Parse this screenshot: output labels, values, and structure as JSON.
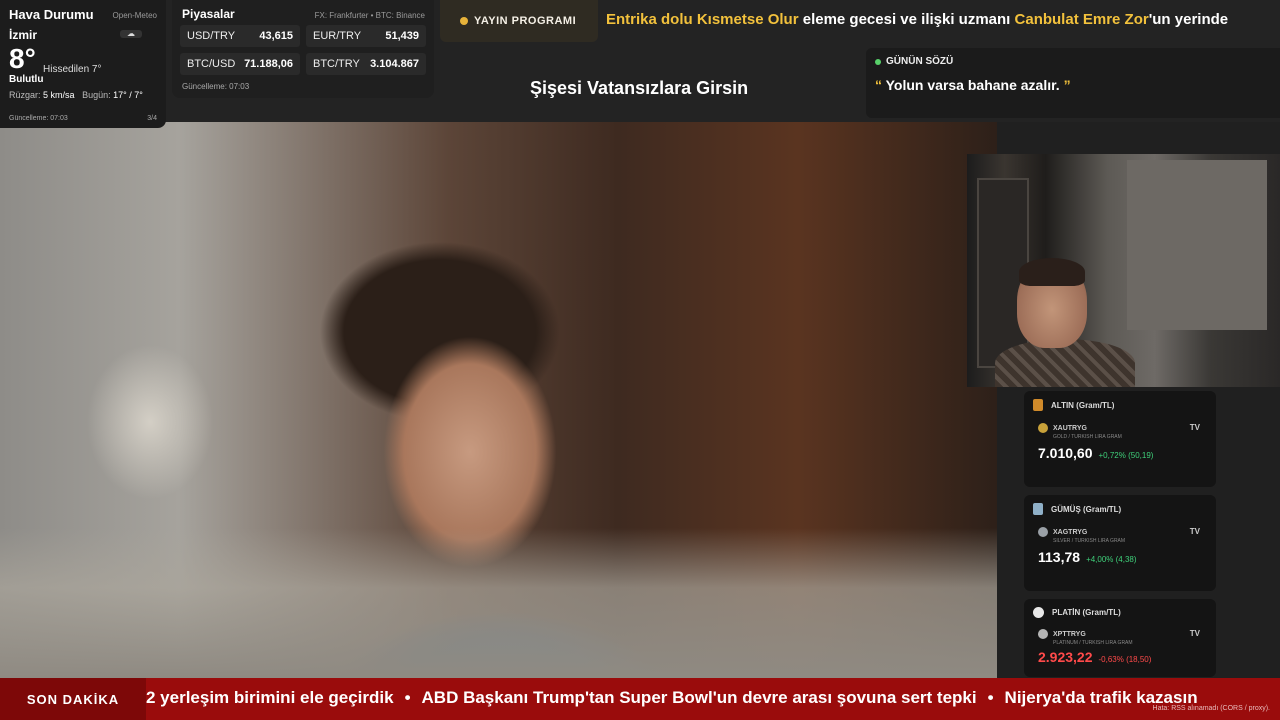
{
  "weather": {
    "title": "Hava Durumu",
    "source": "Open-Meteo",
    "city": "İzmir",
    "temp": "8°",
    "feels_like": "Hissedilen 7°",
    "condition": "Bulutlu",
    "wind_label": "Rüzgar:",
    "wind_value": "5 km/sa",
    "today_label": "Bugün:",
    "today_value": "17° / 7°",
    "updated": "Güncelleme: 07:03",
    "page": "3/4"
  },
  "markets": {
    "title": "Piyasalar",
    "source": "FX: Frankfurter • BTC: Binance",
    "rows": [
      [
        {
          "k": "USD/TRY",
          "v": "43,615"
        },
        {
          "k": "EUR/TRY",
          "v": "51,439"
        }
      ],
      [
        {
          "k": "BTC/USD",
          "v": "71.188,06"
        },
        {
          "k": "BTC/TRY",
          "v": "3.104.867"
        }
      ]
    ],
    "updated": "Güncelleme: 07:03"
  },
  "schedule": {
    "label": "YAYIN PROGRAMI"
  },
  "top_ticker": {
    "parts": [
      {
        "t": "Entrika dolu ",
        "hl": true
      },
      {
        "t": "Kısmetse Olur",
        "hl": true
      },
      {
        "t": " eleme gecesi ve ilişki uzmanı ",
        "hl": false
      },
      {
        "t": "Canbulat Emre Zor",
        "hl": true
      },
      {
        "t": "'un yerinde",
        "hl": false
      }
    ]
  },
  "show_title": "Şişesi Vatansızlara Girsin",
  "quote": {
    "label": "GÜNÜN SÖZÜ",
    "open": "“",
    "text": " Yolun varsa bahane azalır. ",
    "close": "”"
  },
  "prices": [
    {
      "title": "ALTIN (Gram/TL)",
      "symbol": "XAUTRYG",
      "desc": "GOLD / TURKISH LIRA GRAM",
      "price": "7.010,60",
      "change": "+0,72% (50,19)",
      "up": true,
      "medal": "#d08a2a",
      "coin": "#c9a23a"
    },
    {
      "title": "GÜMÜŞ (Gram/TL)",
      "symbol": "XAGTRYG",
      "desc": "SILVER / TURKISH LIRA GRAM",
      "price": "113,78",
      "change": "+4,00% (4,38)",
      "up": true,
      "medal": "#8fb0c8",
      "coin": "#9aa0a6"
    },
    {
      "title": "PLATİN (Gram/TL)",
      "symbol": "XPTTRYG",
      "desc": "PLATINUM / TURKISH LIRA GRAM",
      "price": "2.923,22",
      "change": "-0,63% (18,50)",
      "up": false,
      "medal": "#e8e8e8",
      "coin": "#b5b5b5"
    }
  ],
  "tv_label": "TV",
  "bottom_ticker": {
    "label": "SON DAKİKA",
    "items": [
      "2 yerleşim birimini ele geçirdik",
      "ABD Başkanı Trump'tan Super Bowl'un devre arası şovuna sert tepki",
      "Nijerya'da trafik kazasın"
    ],
    "separator": "•",
    "error": "Hata: RSS alınamadı (CORS / proxy)."
  },
  "colors": {
    "up": "#3fd07a",
    "down": "#ff4a4a",
    "accent": "#f2c13c",
    "breaking": "#9a0c0c"
  }
}
